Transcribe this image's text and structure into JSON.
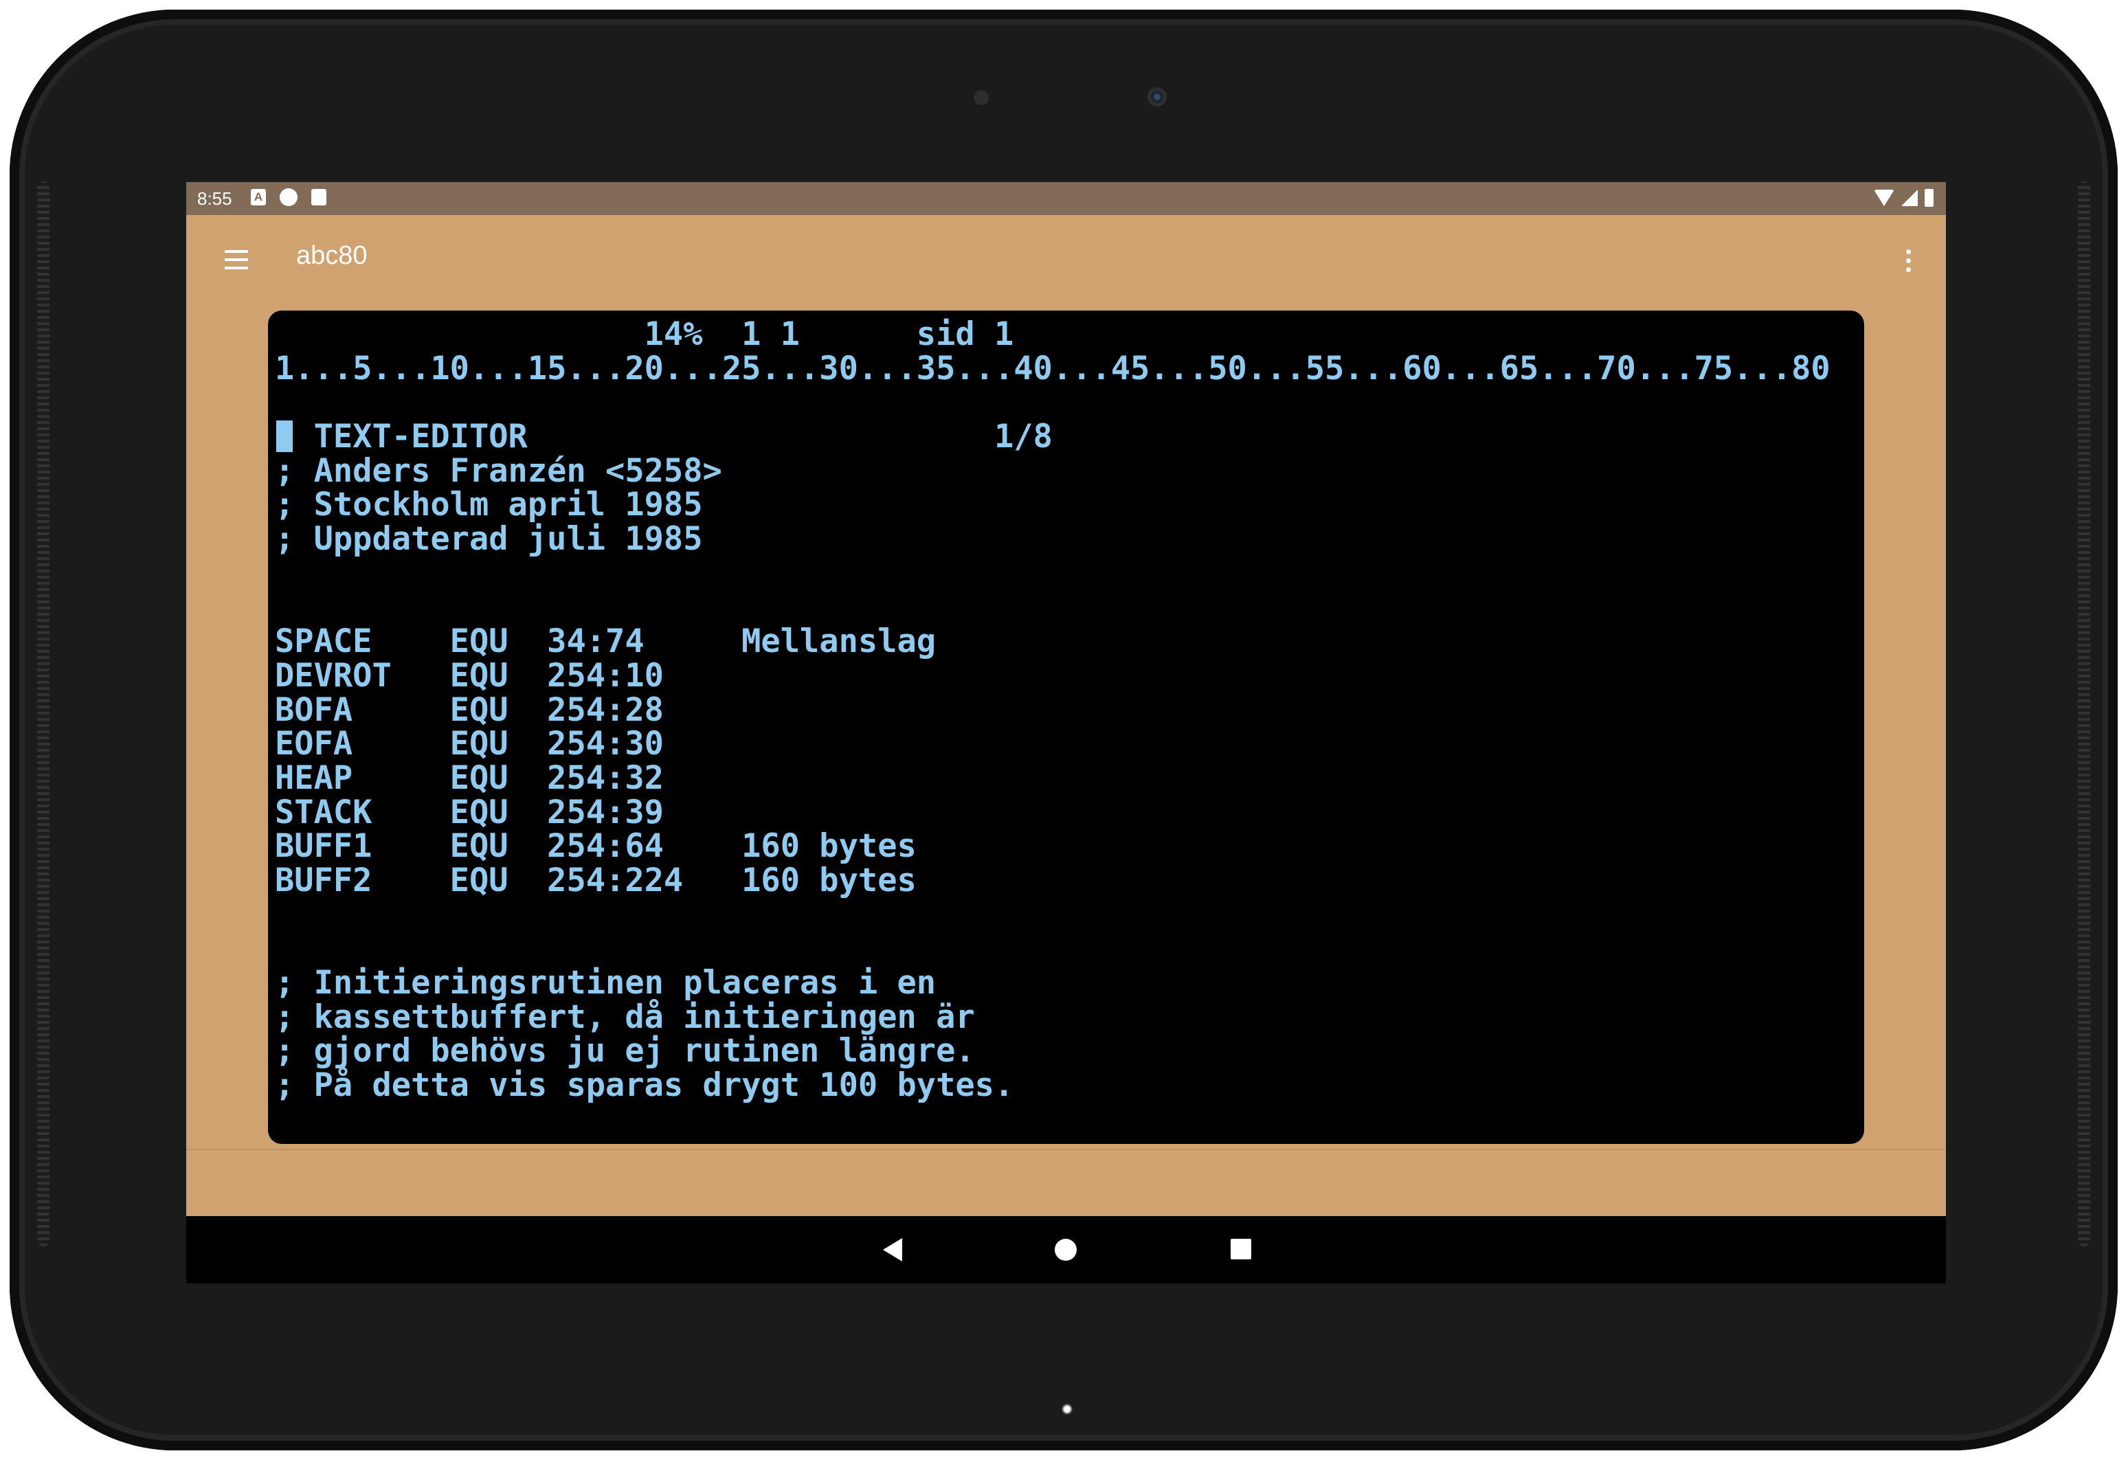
{
  "status_bar": {
    "time": "8:55",
    "left_icons": [
      "a-icon",
      "notification-icon",
      "sd-card-icon"
    ],
    "right_icons": [
      "wifi-icon",
      "signal-icon",
      "battery-icon"
    ]
  },
  "app_bar": {
    "title": "abc80",
    "menu_icon": "hamburger-menu-icon",
    "overflow_icon": "more-vert-icon"
  },
  "terminal": {
    "lines": [
      "                   14%  1 1      sid 1",
      "1...5...10...15...20...25...30...35...40...45...50...55...60...65...70...75...80",
      "",
      "; TEXT-EDITOR                        1/8",
      "; Anders Franzén <5258>",
      "; Stockholm april 1985",
      "; Uppdaterad juli 1985",
      "",
      "",
      "SPACE    EQU  34:74     Mellanslag",
      "DEVROT   EQU  254:10",
      "BOFA     EQU  254:28",
      "EOFA     EQU  254:30",
      "HEAP     EQU  254:32",
      "STACK    EQU  254:39",
      "BUFF1    EQU  254:64    160 bytes",
      "BUFF2    EQU  254:224   160 bytes",
      "",
      "",
      "; Initieringsrutinen placeras i en",
      "; kassettbuffert, då initieringen är",
      "; gjord behövs ju ej rutinen längre.",
      "; På detta vis sparas drygt 100 bytes."
    ]
  },
  "nav_bar": {
    "back_icon": "back-triangle-icon",
    "home_icon": "home-circle-icon",
    "recents_icon": "recents-square-icon"
  },
  "colors": {
    "accent": "#cfa26f",
    "status_bar": "#826c57",
    "terminal_bg": "#000000",
    "terminal_text": "#8fcbf0"
  }
}
